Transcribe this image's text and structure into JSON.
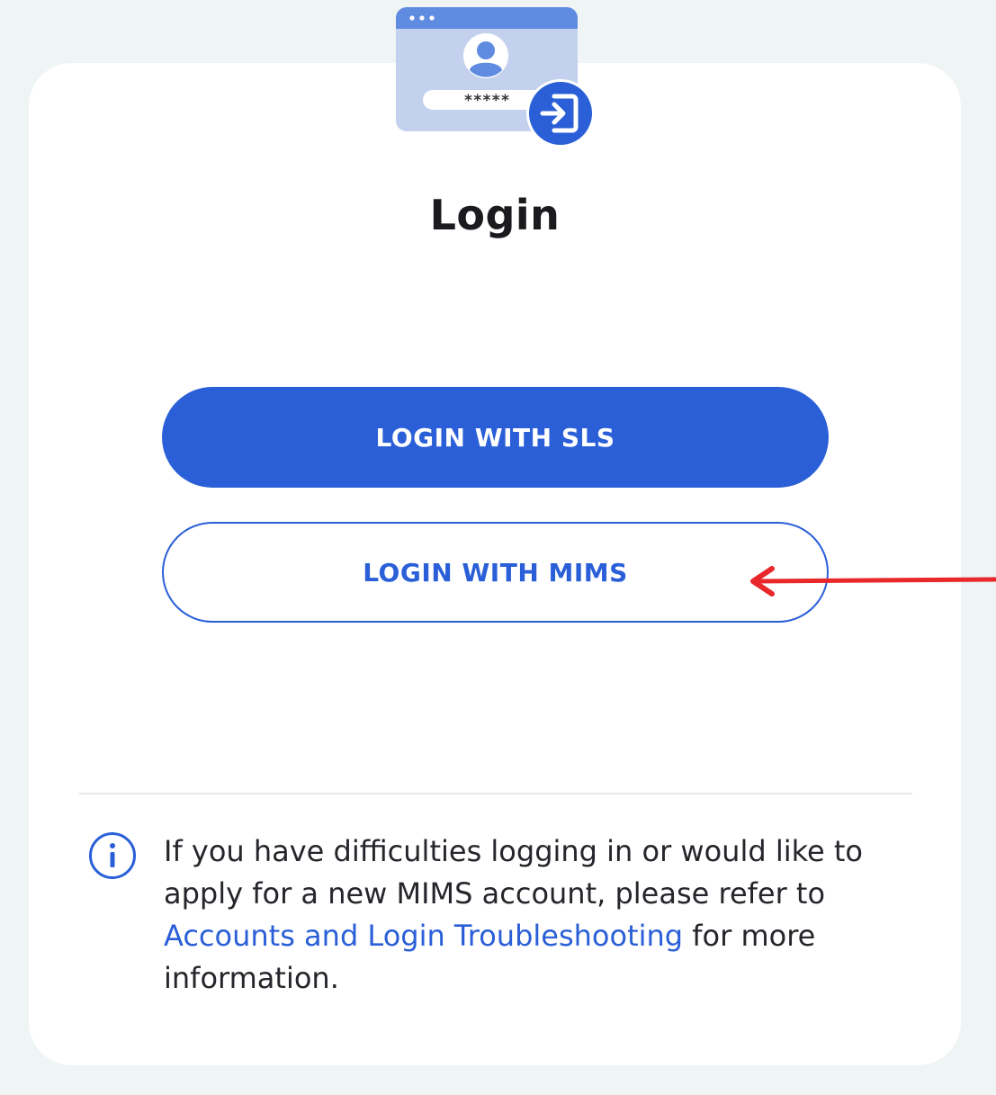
{
  "login": {
    "hero_password_mask": "*****",
    "title": "Login",
    "sls_button_label": "LOGIN WITH SLS",
    "mims_button_label": "LOGIN WITH MIMS"
  },
  "info": {
    "text_before_link": "If you have difficulties logging in or would like to apply for a new MIMS account, please refer to ",
    "link_text": "Accounts and Login Troubleshooting",
    "text_after_link": " for more information."
  },
  "icons": {
    "hero": "login-illustration-icon",
    "info": "info-icon",
    "annotation": "annotation-arrow-icon"
  },
  "colors": {
    "primary": "#2a5fd7",
    "background": "#eff4f5",
    "card": "#ffffff",
    "annotation_arrow": "#e8282b"
  }
}
